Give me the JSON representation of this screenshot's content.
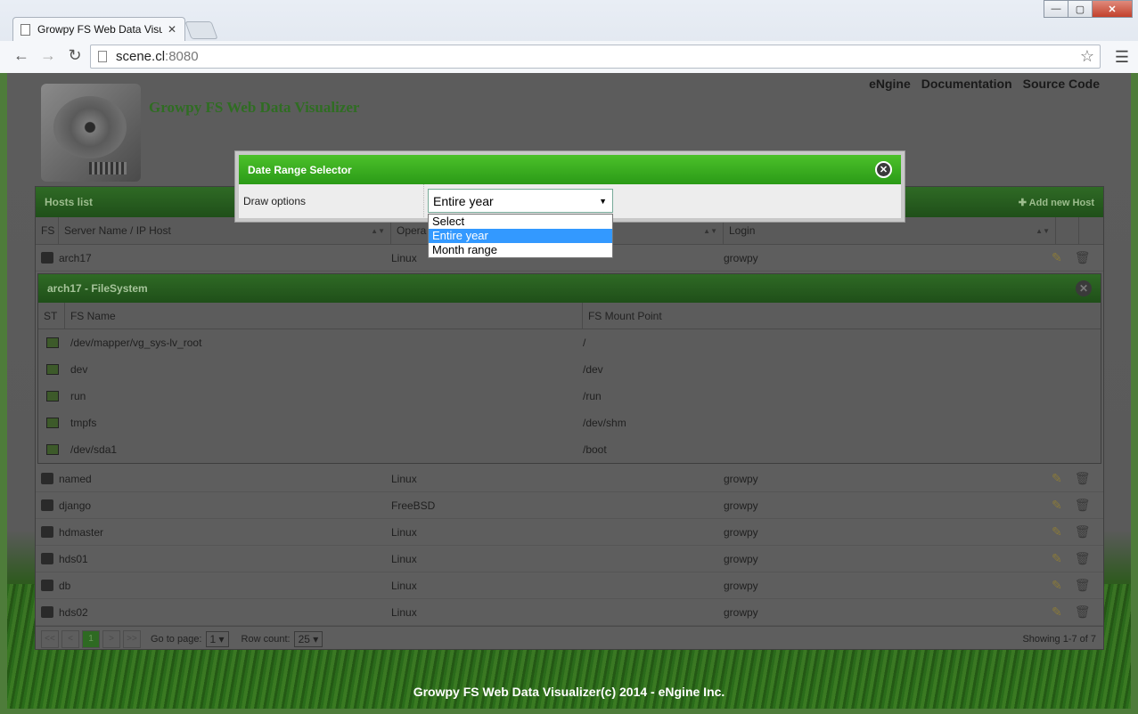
{
  "browser": {
    "tab_title": "Growpy FS Web Data Visualizer",
    "url_host": "scene.cl",
    "url_port": ":8080"
  },
  "header": {
    "app_title": "Growpy FS Web Data Visualizer",
    "nav": [
      "eNgine",
      "Documentation",
      "Source Code"
    ]
  },
  "hosts": {
    "title": "Hosts list",
    "add_label": "Add new Host",
    "columns": [
      "FS",
      "Server Name / IP Host",
      "Opera",
      "Login"
    ],
    "first_row": {
      "name": "arch17",
      "os": "Linux",
      "login": "growpy"
    },
    "rows": [
      {
        "name": "named",
        "os": "Linux",
        "login": "growpy"
      },
      {
        "name": "django",
        "os": "FreeBSD",
        "login": "growpy"
      },
      {
        "name": "hdmaster",
        "os": "Linux",
        "login": "growpy"
      },
      {
        "name": "hds01",
        "os": "Linux",
        "login": "growpy"
      },
      {
        "name": "db",
        "os": "Linux",
        "login": "growpy"
      },
      {
        "name": "hds02",
        "os": "Linux",
        "login": "growpy"
      }
    ]
  },
  "filesystem": {
    "title": "arch17 - FileSystem",
    "columns": [
      "ST",
      "FS Name",
      "FS Mount Point"
    ],
    "rows": [
      {
        "name": "/dev/mapper/vg_sys-lv_root",
        "mount": "/"
      },
      {
        "name": "dev",
        "mount": "/dev"
      },
      {
        "name": "run",
        "mount": "/run"
      },
      {
        "name": "tmpfs",
        "mount": "/dev/shm"
      },
      {
        "name": "/dev/sda1",
        "mount": "/boot"
      }
    ]
  },
  "pager": {
    "first": "<<",
    "prev": "<",
    "current": "1",
    "next": ">",
    "last": ">>",
    "goto_label": "Go to page:",
    "goto_value": "1",
    "rowcount_label": "Row count:",
    "rowcount_value": "25",
    "showing": "Showing 1-7 of 7"
  },
  "footer": "Growpy FS Web Data Visualizer(c) 2014 - eNgine Inc.",
  "modal": {
    "title": "Date Range Selector",
    "draw_label": "Draw options",
    "selected": "Entire year",
    "options": [
      "Select",
      "Entire year",
      "Month range"
    ]
  }
}
